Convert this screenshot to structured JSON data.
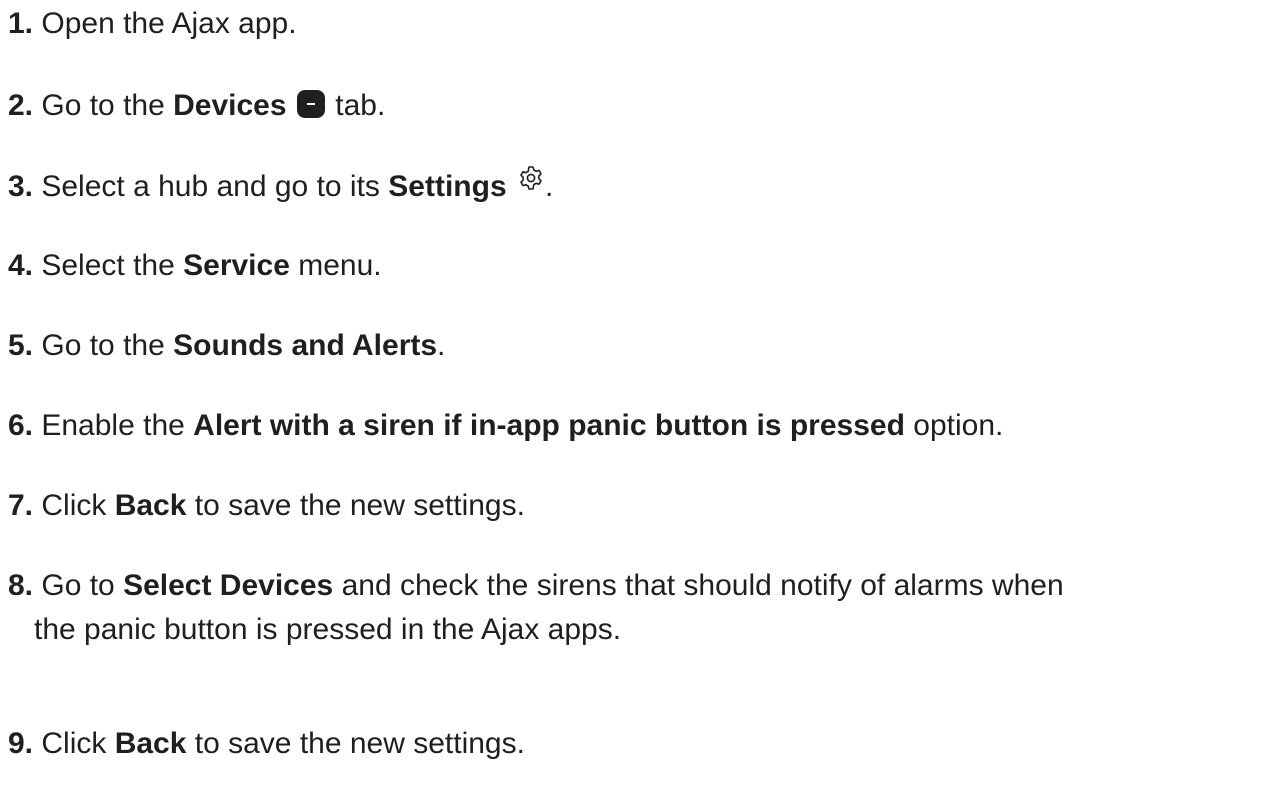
{
  "steps": [
    {
      "num": "1.",
      "pre": " Open the Ajax app.",
      "bold": "",
      "post": ""
    },
    {
      "num": "2.",
      "pre": " Go to the ",
      "bold": "Devices",
      "post": " tab.",
      "icon": "devices-tab-icon"
    },
    {
      "num": "3.",
      "pre": " Select a hub and go to its ",
      "bold": "Settings",
      "post": ".",
      "icon": "gear-icon"
    },
    {
      "num": "4.",
      "pre": " Select the ",
      "bold": "Service",
      "post": " menu."
    },
    {
      "num": "5.",
      "pre": " Go to the ",
      "bold": "Sounds and Alerts",
      "post": "."
    },
    {
      "num": "6.",
      "pre": " Enable the ",
      "bold": "Alert with a siren if in-app panic button is pressed",
      "post": " option."
    },
    {
      "num": "7.",
      "pre": " Click ",
      "bold": "Back",
      "post": " to save the new settings."
    },
    {
      "num": "8.",
      "pre": " Go to ",
      "bold": "Select Devices",
      "post": " and check the sirens that should notify of alarms when",
      "cont": "the panic button is pressed in the Ajax apps."
    },
    {
      "num": "9.",
      "pre": " Click ",
      "bold": "Back",
      "post": " to save the new settings."
    }
  ]
}
